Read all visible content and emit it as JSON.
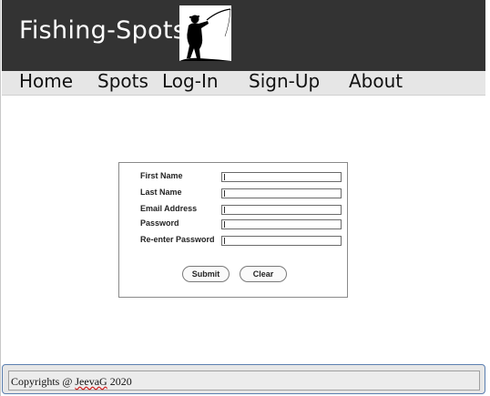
{
  "header": {
    "title": "Fishing-Spots",
    "logo_icon": "fisherman-icon"
  },
  "nav": {
    "items": [
      {
        "label": "Home"
      },
      {
        "label": "Spots"
      },
      {
        "label": "Log-In"
      },
      {
        "label": "Sign-Up"
      },
      {
        "label": "About"
      }
    ]
  },
  "form": {
    "fields": [
      {
        "label": "First Name",
        "value": ""
      },
      {
        "label": "Last Name",
        "value": ""
      },
      {
        "label": "Email Address",
        "value": ""
      },
      {
        "label": "Password",
        "value": ""
      },
      {
        "label": "Re-enter Password",
        "value": ""
      }
    ],
    "submit_label": "Submit",
    "clear_label": "Clear"
  },
  "footer": {
    "prefix": "Copyrights @ ",
    "author": "JeevaG",
    "suffix": " 2020"
  },
  "colors": {
    "header_bg": "#333333",
    "nav_bg": "#e6e6e6",
    "footer_border": "#5b7fb0",
    "spellcheck_underline": "#d02020"
  }
}
